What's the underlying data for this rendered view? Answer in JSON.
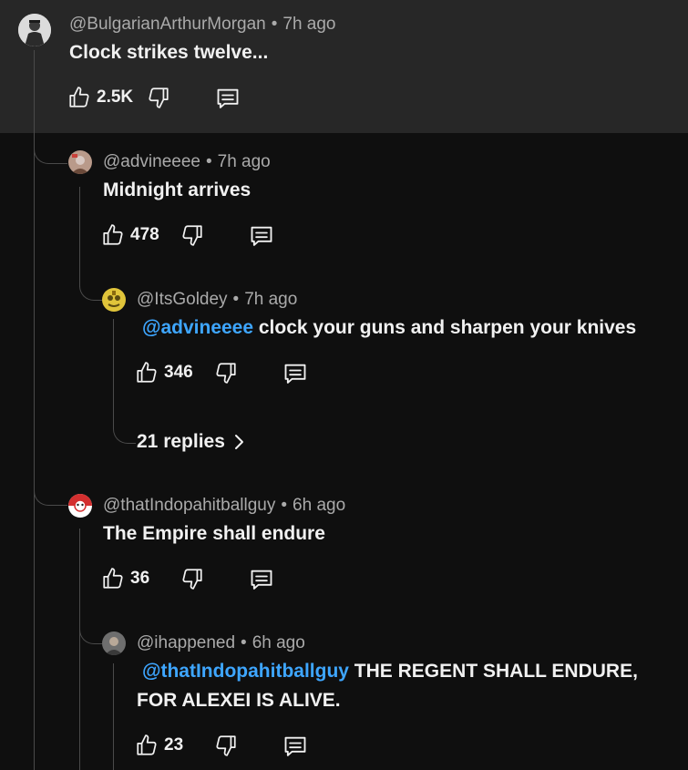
{
  "comments": [
    {
      "handle": "@BulgarianArthurMorgan",
      "time": "7h ago",
      "text": "Clock strikes twelve...",
      "likes": "2.5K"
    },
    {
      "handle": "@advineeee",
      "time": "7h ago",
      "text": "Midnight arrives",
      "likes": "478"
    },
    {
      "handle": "@ItsGoldey",
      "time": "7h ago",
      "mention": "@advineeee",
      "text": " clock your guns and sharpen your knives",
      "likes": "346"
    },
    {
      "handle": "@thatIndopahitballguy",
      "time": "6h ago",
      "text": "The Empire shall endure",
      "likes": "36"
    },
    {
      "handle": "@ihappened",
      "time": "6h ago",
      "mention": "@thatIndopahitballguy",
      "text_line1": " THE REGENT SHALL ENDURE,",
      "text_line2": "FOR ALEXEI IS ALIVE.",
      "likes": "23"
    }
  ],
  "replies_link": {
    "label": "21 replies"
  },
  "colors": {
    "background": "#0f0f0f",
    "highlight": "#272727",
    "mention": "#3ea6ff",
    "meta": "#aaaaaa"
  },
  "icons": [
    "thumbs-up-icon",
    "thumbs-down-icon",
    "reply-icon",
    "chevron-right-icon"
  ]
}
